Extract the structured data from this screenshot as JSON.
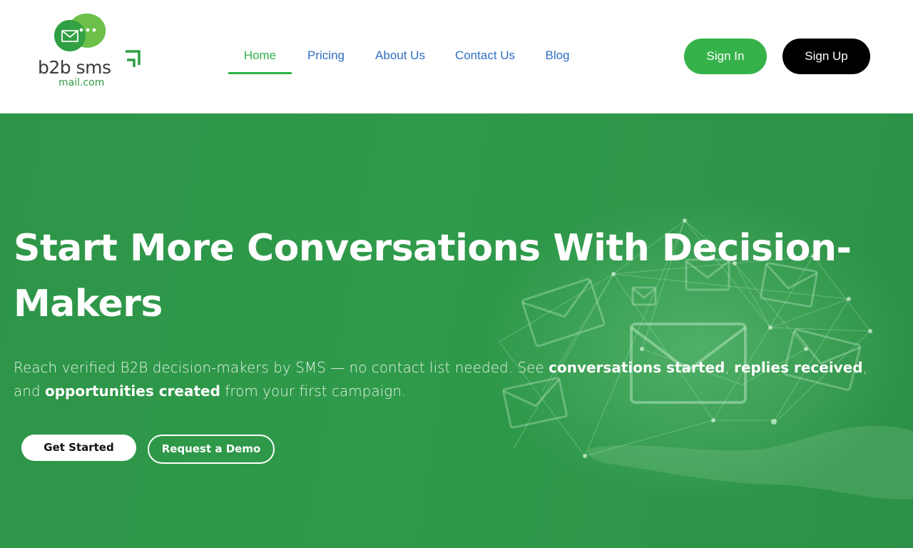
{
  "brand": {
    "logo_text": "b2b sms",
    "logo_subtext": "mail.com",
    "primary_color": "#36b24a",
    "hero_color": "#2f9a4a",
    "nav_link_color": "#2f6fc4"
  },
  "nav": {
    "items": [
      {
        "label": "Home",
        "active": true
      },
      {
        "label": "Pricing",
        "active": false
      },
      {
        "label": "About Us",
        "active": false
      },
      {
        "label": "Contact Us",
        "active": false
      },
      {
        "label": "Blog",
        "active": false
      }
    ]
  },
  "header_actions": {
    "sign_in": "Sign In",
    "sign_up": "Sign Up"
  },
  "hero": {
    "title": "Start More Conversations With Decision-Makers",
    "desc_part1": "Reach verified B2B decision-makers by SMS — no contact list needed. See ",
    "desc_bold1": "conversations started",
    "desc_part2": ", ",
    "desc_bold2": "replies received",
    "desc_part3": ", and ",
    "desc_bold3": "opportunities created",
    "desc_part4": " from your first campaign.",
    "cta_primary": "Get Started",
    "cta_secondary": "Request a Demo"
  }
}
